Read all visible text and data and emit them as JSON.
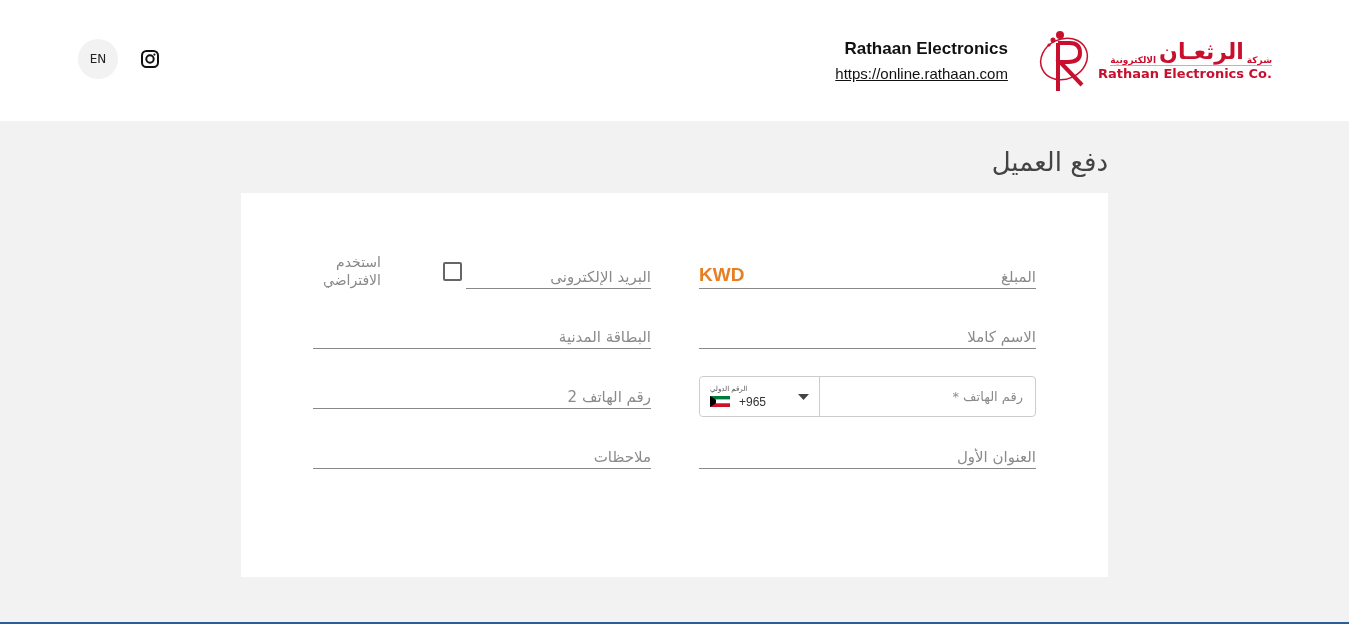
{
  "header": {
    "language_button": "EN",
    "company_name": "Rathaan Electronics",
    "website_link": "https://online.rathaan.com",
    "logo": {
      "prefix": "شركة",
      "name": "الرثعـان",
      "suffix": "الالكترونية",
      "english": "Rathaan Electronics Co."
    }
  },
  "page_title": "دفع العميل",
  "form": {
    "fields": [
      {
        "kind": "amount",
        "placeholder": "المبلغ",
        "currency": "KWD"
      },
      {
        "kind": "email",
        "placeholder": "البريد الإلكترونى",
        "checkbox_label": "استخدم الافتراضي",
        "checked": false
      },
      {
        "kind": "text",
        "placeholder": "الاسم كاملا"
      },
      {
        "kind": "text",
        "placeholder": "البطاقة المدنية"
      },
      {
        "kind": "phone",
        "placeholder": "رقم الهاتف *",
        "country_label": "الرقم الدولي",
        "dial_code": "+965"
      },
      {
        "kind": "text",
        "placeholder": "رقم الهاتف 2"
      },
      {
        "kind": "text",
        "placeholder": "العنوان الأول"
      },
      {
        "kind": "text",
        "placeholder": "ملاحظات"
      }
    ]
  }
}
